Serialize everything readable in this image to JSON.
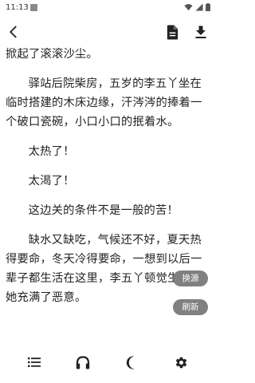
{
  "status_bar": {
    "time": "11:13",
    "icons": [
      "notification-icon",
      "wifi-icon",
      "signal-icon",
      "battery-icon"
    ]
  },
  "toolbar": {
    "back_icon": "arrow-back-icon",
    "document_icon": "document-icon",
    "download_icon": "download-icon"
  },
  "content": {
    "paragraphs": [
      "掀起了滚滚沙尘。",
      "驿站后院柴房，五岁的李五丫坐在临时搭建的木床边缘，汗涔涔的捧着一个破口瓷碗，小口小口的抿着水。",
      "太热了！",
      "太渴了！",
      "这边关的条件不是一般的苦！",
      "缺水又缺吃，气候还不好，夏天热得要命，冬天冷得要命，一想到以后一辈子都生活在这里，李五丫顿觉生活对她充满了恶意。"
    ]
  },
  "floating": {
    "switch_source": "换源",
    "refresh": "刷新"
  },
  "bottom_bar": {
    "icons": [
      "list-icon",
      "headphones-icon",
      "moon-icon",
      "settings-icon"
    ]
  }
}
